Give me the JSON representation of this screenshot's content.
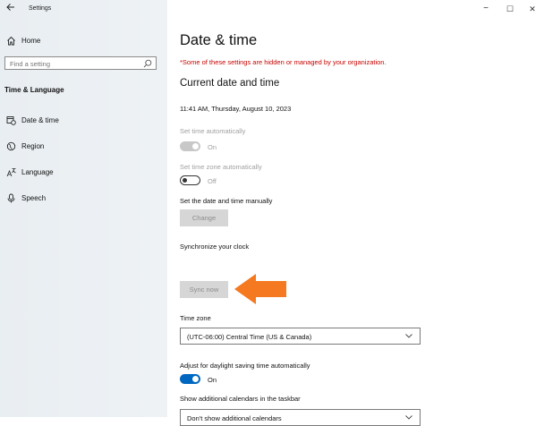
{
  "window": {
    "title": "Settings",
    "controls": {
      "minimize": "−",
      "maximize": "☐",
      "close": "✕"
    }
  },
  "sidebar": {
    "home_label": "Home",
    "search_placeholder": "Find a setting",
    "section_header": "Time & Language",
    "items": [
      {
        "label": "Date & time",
        "icon": "calendar-clock-icon"
      },
      {
        "label": "Region",
        "icon": "globe-icon"
      },
      {
        "label": "Language",
        "icon": "language-icon"
      },
      {
        "label": "Speech",
        "icon": "microphone-icon"
      }
    ]
  },
  "main": {
    "title": "Date & time",
    "org_notice": "*Some of these settings are hidden or managed by your organization.",
    "current_header": "Current date and time",
    "current_datetime": "11:41 AM, Thursday, August 10, 2023",
    "set_time_auto": {
      "label": "Set time automatically",
      "state": "On"
    },
    "set_tz_auto": {
      "label": "Set time zone automatically",
      "state": "Off"
    },
    "manual": {
      "label": "Set the date and time manually",
      "button": "Change"
    },
    "sync": {
      "label": "Synchronize your clock",
      "button": "Sync now"
    },
    "timezone": {
      "label": "Time zone",
      "value": "(UTC-06:00) Central Time (US & Canada)"
    },
    "dst": {
      "label": "Adjust for daylight saving time automatically",
      "state": "On"
    },
    "calendars": {
      "label": "Show additional calendars in the taskbar",
      "value": "Don't show additional calendars"
    }
  },
  "colors": {
    "accent": "#0067c0",
    "annotation_arrow": "#f47920",
    "warning": "#c50500"
  }
}
